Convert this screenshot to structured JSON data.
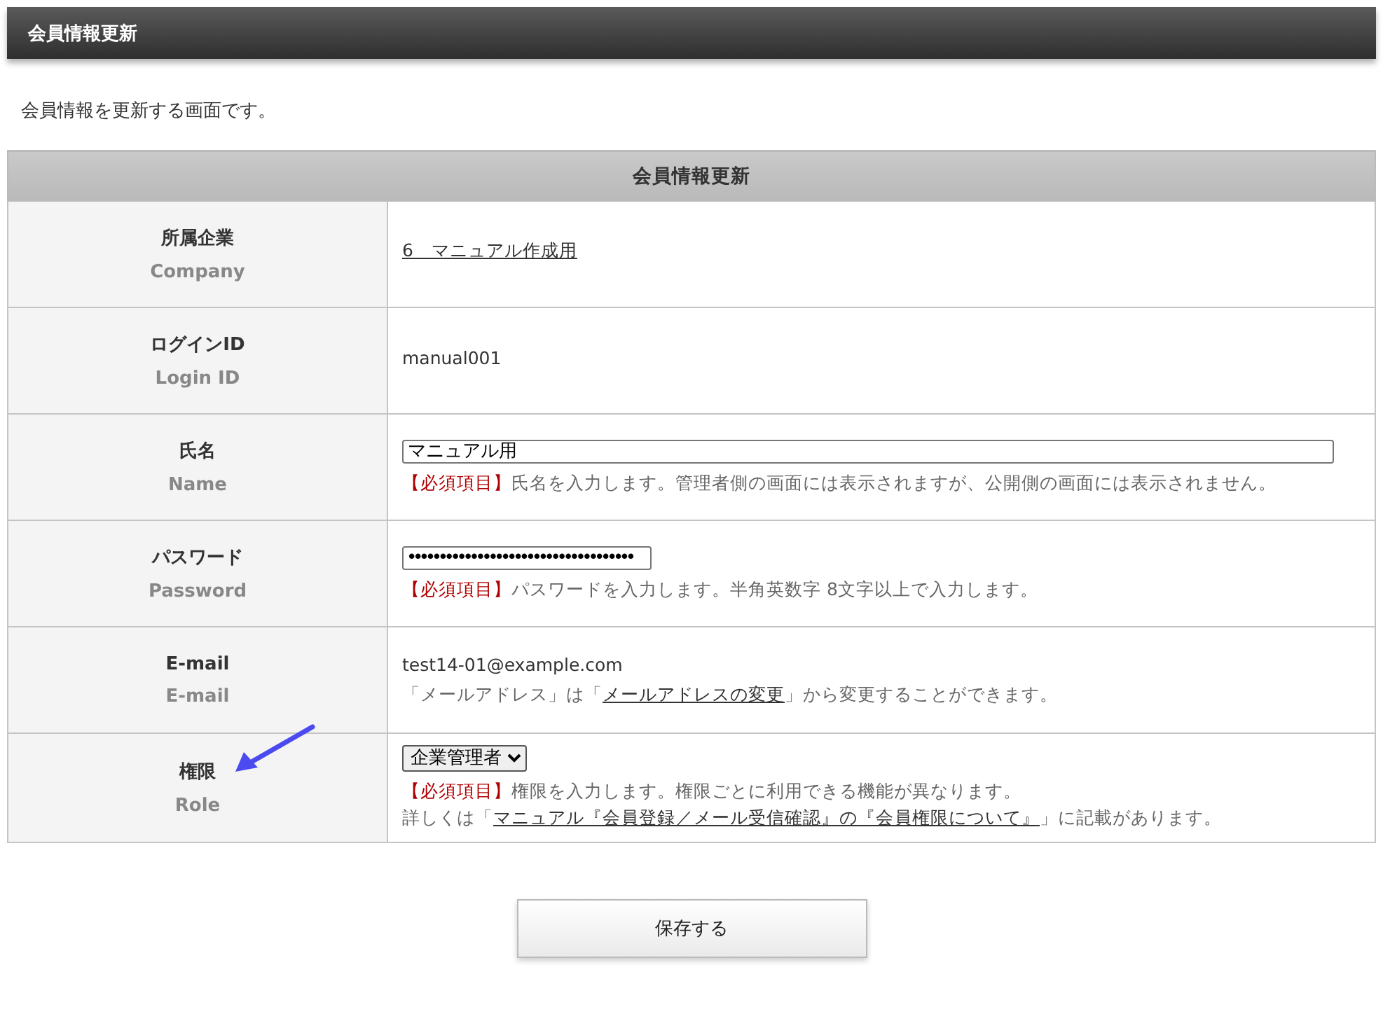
{
  "page_title": "会員情報更新",
  "description": "会員情報を更新する画面です。",
  "table": {
    "title": "会員情報更新",
    "rows": [
      {
        "label": "所属企業",
        "label_en": "Company",
        "kind": "link",
        "value": "6　マニュアル作成用",
        "notes": []
      },
      {
        "label": "ログインID",
        "label_en": "Login ID",
        "kind": "text",
        "value": "manual001",
        "notes": []
      },
      {
        "label": "氏名",
        "label_en": "Name",
        "kind": "input",
        "value": "マニュアル用",
        "notes": [
          [
            {
              "kind": "required",
              "text": "【必須項目】"
            },
            {
              "kind": "text",
              "text": "氏名を入力します。管理者側の画面には表示されますが、公開側の画面には表示されません。"
            }
          ]
        ]
      },
      {
        "label": "パスワード",
        "label_en": "Password",
        "kind": "password",
        "value": "••••••••••••••••••••••••••••••••••••",
        "notes": [
          [
            {
              "kind": "required",
              "text": "【必須項目】"
            },
            {
              "kind": "text",
              "text": "パスワードを入力します。半角英数字 8文字以上で入力します。"
            }
          ]
        ]
      },
      {
        "label": "E-mail",
        "label_en": "E-mail",
        "kind": "text",
        "value": "test14-01@example.com",
        "notes": [
          [
            {
              "kind": "text",
              "text": "「メールアドレス」は「"
            },
            {
              "kind": "link",
              "text": "メールアドレスの変更"
            },
            {
              "kind": "text",
              "text": "」から変更することができます。"
            }
          ]
        ]
      },
      {
        "label": "権限",
        "label_en": "Role",
        "kind": "select",
        "value": "企業管理者",
        "annotated": true,
        "notes": [
          [
            {
              "kind": "required",
              "text": "【必須項目】"
            },
            {
              "kind": "text",
              "text": "権限を入力します。権限ごとに利用できる機能が異なります。"
            }
          ],
          [
            {
              "kind": "text",
              "text": "詳しくは「"
            },
            {
              "kind": "link",
              "text": "マニュアル『会員登録／メール受信確認』の『会員権限について』"
            },
            {
              "kind": "text",
              "text": "」に記載があります。"
            }
          ]
        ]
      }
    ]
  },
  "save_button": "保存する"
}
